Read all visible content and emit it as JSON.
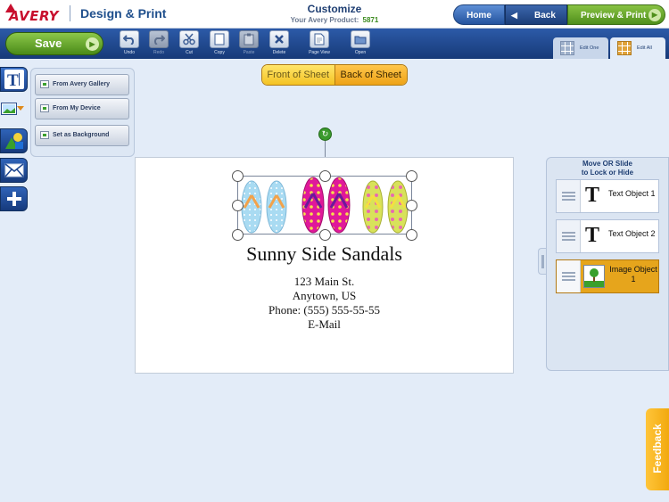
{
  "header": {
    "logo": "AVERY",
    "app_name": "Design & Print",
    "title": "Customize",
    "product_label": "Your Avery Product:",
    "product_number": "5871",
    "nav": {
      "home": "Home",
      "back": "Back",
      "preview": "Preview & Print"
    }
  },
  "toolbar": {
    "save": "Save",
    "tools": [
      {
        "label": "Undo",
        "icon": "undo-icon",
        "enabled": true
      },
      {
        "label": "Redo",
        "icon": "redo-icon",
        "enabled": false
      },
      {
        "label": "Cut",
        "icon": "scissors-icon",
        "enabled": true
      },
      {
        "label": "Copy",
        "icon": "copy-icon",
        "enabled": true
      },
      {
        "label": "Paste",
        "icon": "paste-icon",
        "enabled": false
      },
      {
        "label": "Delete",
        "icon": "delete-icon",
        "enabled": true
      },
      {
        "label": "Page View",
        "icon": "page-view-icon",
        "enabled": true
      },
      {
        "label": "Open",
        "icon": "open-icon",
        "enabled": true
      }
    ],
    "edit_one": "Edit One",
    "edit_all": "Edit All"
  },
  "image_panel": {
    "buttons": [
      "From Avery Gallery",
      "From My Device",
      "Set as Background"
    ]
  },
  "sheet_toggle": {
    "front": "Front of Sheet",
    "back": "Back of Sheet"
  },
  "card": {
    "title": "Sunny Side Sandals",
    "lines": [
      "123 Main St.",
      "Anytown, US",
      "Phone: (555) 555-55-55",
      "E-Mail"
    ]
  },
  "objects_panel": {
    "title_line1": "Move OR Slide",
    "title_line2": "to Lock or Hide",
    "items": [
      {
        "label": "Text Object 1",
        "type": "text",
        "selected": false
      },
      {
        "label": "Text Object 2",
        "type": "text",
        "selected": false
      },
      {
        "label": "Image Object 1",
        "type": "image",
        "selected": true
      }
    ]
  },
  "feedback": "Feedback",
  "colors": {
    "toolbar": "#1f4a92",
    "save_green": "#6bab2e",
    "accent_orange": "#e6a51c",
    "brand_red": "#c8102e"
  }
}
